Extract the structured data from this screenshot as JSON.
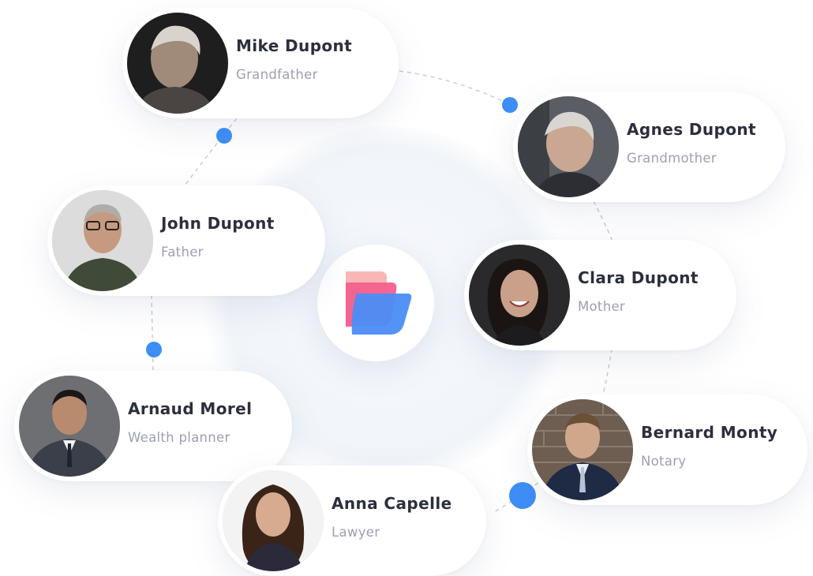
{
  "people": [
    {
      "name": "Mike Dupont",
      "role": "Grandfather",
      "avatar": "elderly-man-portrait"
    },
    {
      "name": "Agnes Dupont",
      "role": "Grandmother",
      "avatar": "elderly-woman-portrait"
    },
    {
      "name": "John Dupont",
      "role": "Father",
      "avatar": "man-with-glasses-portrait"
    },
    {
      "name": "Clara Dupont",
      "role": "Mother",
      "avatar": "laughing-woman-portrait"
    },
    {
      "name": "Arnaud Morel",
      "role": "Wealth planner",
      "avatar": "man-in-suit-portrait"
    },
    {
      "name": "Bernard Monty",
      "role": "Notary",
      "avatar": "man-in-suit-brick-wall-portrait"
    },
    {
      "name": "Anna Capelle",
      "role": "Lawyer",
      "avatar": "woman-with-long-hair-portrait"
    }
  ],
  "center_logo": "layered-shapes-logo",
  "colors": {
    "accent_blue": "#3d8ef7",
    "logo_pink": "#f25f8f",
    "logo_peach": "#f7b8b5",
    "logo_blue": "#4a8df6",
    "name_text": "#2b2f3d",
    "role_text": "#9aa1b0"
  }
}
